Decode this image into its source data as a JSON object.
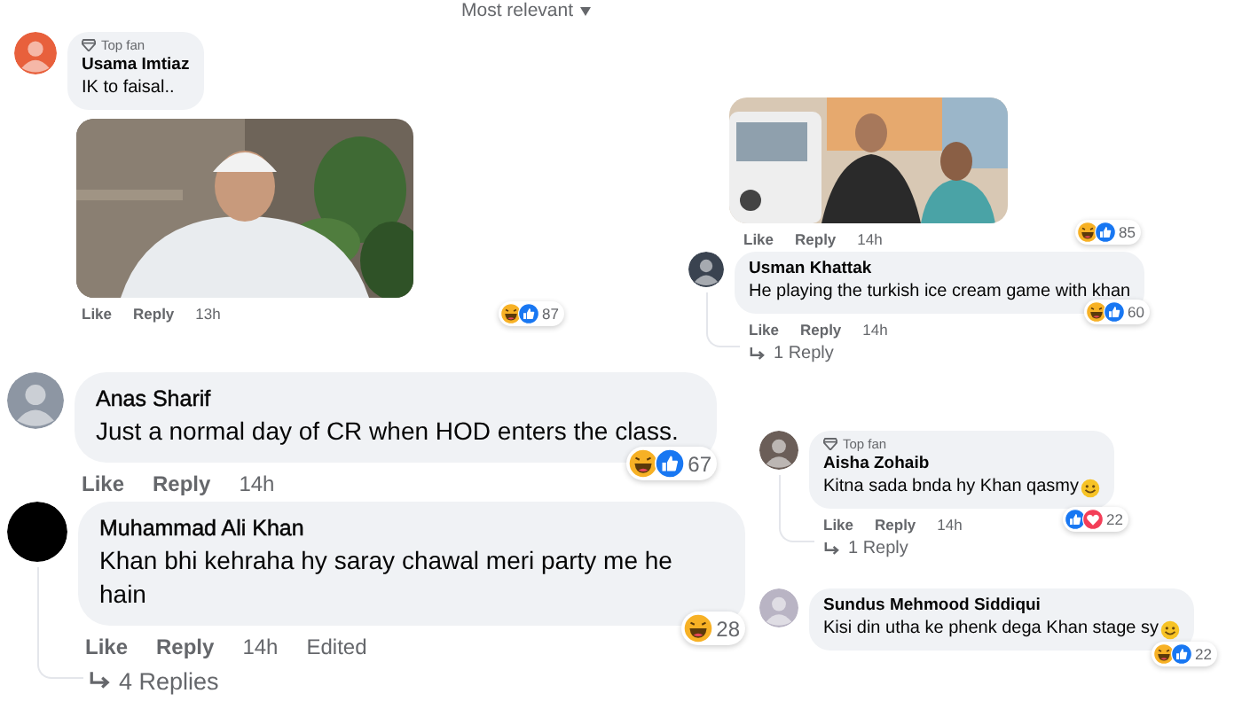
{
  "sort_menu": {
    "label": "Most relevant"
  },
  "comments": [
    {
      "badge": "Top fan",
      "author": "Usama Imtiaz",
      "text": "IK to faisal..",
      "attachment": {
        "kind": "picture"
      },
      "actions": [
        {
          "kind": "link",
          "label": "Like"
        },
        {
          "kind": "link",
          "label": "Reply"
        },
        {
          "kind": "meta",
          "label": "13h"
        }
      ],
      "reactions": {
        "count": "87"
      }
    },
    {
      "attachment": {
        "kind": "picture"
      },
      "actions": [
        {
          "kind": "link",
          "label": "Like"
        },
        {
          "kind": "link",
          "label": "Reply"
        },
        {
          "kind": "meta",
          "label": "14h"
        }
      ],
      "reactions": {
        "count": "85"
      }
    },
    {
      "author": "Usman Khattak",
      "text": "He playing the turkish ice cream game with khan",
      "actions": [
        {
          "kind": "link",
          "label": "Like"
        },
        {
          "kind": "link",
          "label": "Reply"
        },
        {
          "kind": "meta",
          "label": "14h"
        }
      ],
      "reactions": {
        "count": "60"
      },
      "replies": "1 Reply"
    },
    {
      "author": "Anas Sharif",
      "text": "Just a normal day of CR when HOD enters the class.",
      "actions": [
        {
          "kind": "link",
          "label": "Like"
        },
        {
          "kind": "link",
          "label": "Reply"
        },
        {
          "kind": "meta",
          "label": "14h"
        }
      ],
      "reactions": {
        "count": "67"
      }
    },
    {
      "author": "Muhammad Ali Khan",
      "text": "Khan bhi kehraha hy saray chawal meri party me he hain",
      "actions": [
        {
          "kind": "link",
          "label": "Like"
        },
        {
          "kind": "link",
          "label": "Reply"
        },
        {
          "kind": "meta",
          "label": "14h"
        },
        {
          "kind": "meta",
          "label": "Edited"
        }
      ],
      "reactions": {
        "count": "28"
      },
      "replies": "4 Replies"
    },
    {
      "badge": "Top fan",
      "author": "Aisha Zohaib",
      "text": "Kitna sada bnda hy Khan qasmy",
      "actions": [
        {
          "kind": "link",
          "label": "Like"
        },
        {
          "kind": "link",
          "label": "Reply"
        },
        {
          "kind": "meta",
          "label": "14h"
        }
      ],
      "reactions": {
        "count": "22"
      },
      "replies": "1 Reply"
    },
    {
      "author": "Sundus Mehmood Siddiqui",
      "text": "Kisi din utha ke phenk dega Khan stage sy",
      "reactions": {
        "count": "22"
      }
    }
  ]
}
